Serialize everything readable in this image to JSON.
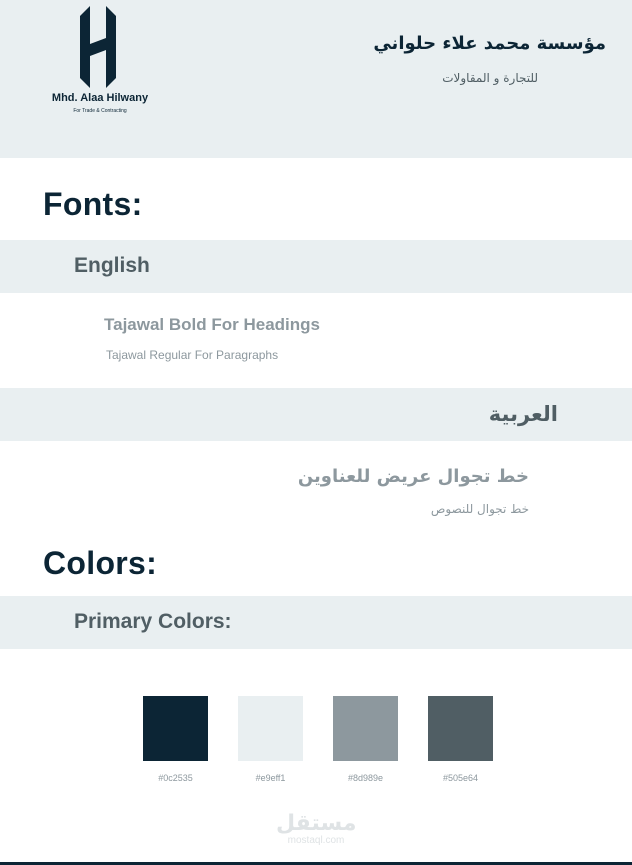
{
  "header": {
    "logo_name": "Mhd. Alaa Hilwany",
    "logo_tagline": "For Trade & Contracting",
    "company_name_ar": "مؤسسة محمد علاء حلواني",
    "company_sub_ar": "للتجارة و المقاولات"
  },
  "fonts": {
    "title": "Fonts:",
    "english": {
      "label": "English",
      "heading_sample": "Tajawal Bold For Headings",
      "paragraph_sample": "Tajawal Regular For Paragraphs"
    },
    "arabic": {
      "label": "العربية",
      "heading_sample": "خط تجوال عريض للعناوين",
      "paragraph_sample": "خط تجوال للنصوص"
    }
  },
  "colors": {
    "title": "Colors:",
    "primary_label": "Primary Colors:",
    "swatches": [
      {
        "hex": "#0c2535",
        "label": "#0c2535"
      },
      {
        "hex": "#e9eff1",
        "label": "#e9eff1"
      },
      {
        "hex": "#8d989e",
        "label": "#8d989e"
      },
      {
        "hex": "#505e64",
        "label": "#505e64"
      }
    ]
  },
  "watermark": {
    "ar": "مستقل",
    "en": "mostaql.com"
  }
}
